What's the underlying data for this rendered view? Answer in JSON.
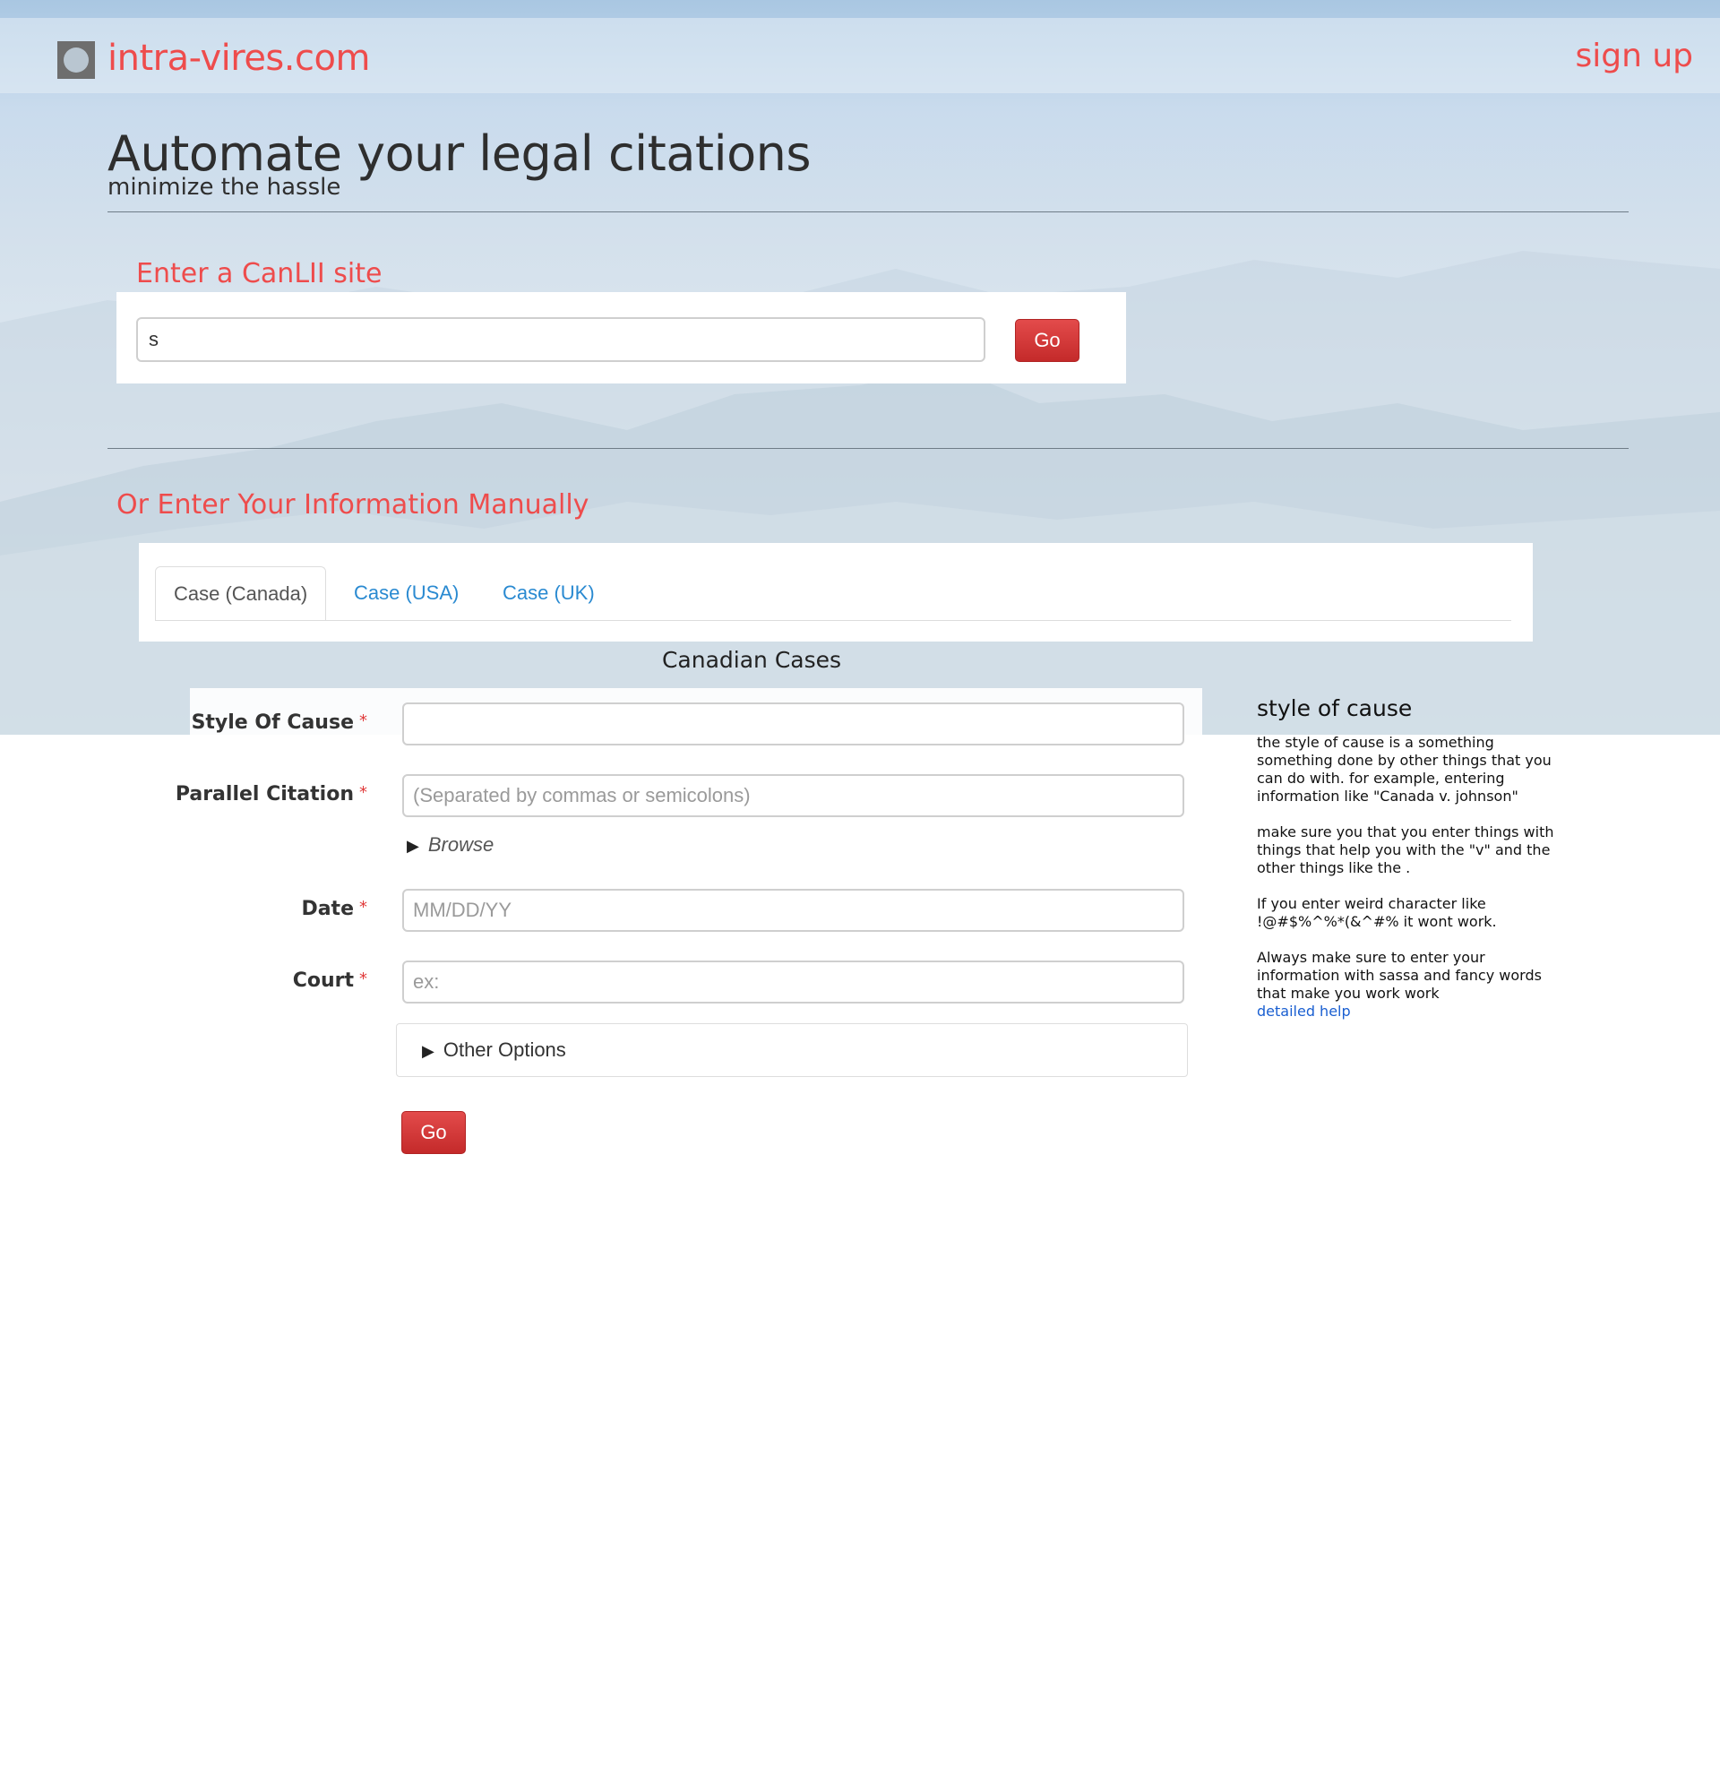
{
  "navbar": {
    "brand": "intra-vires.com",
    "signup": "sign up"
  },
  "hero": {
    "title": "Automate your legal citations",
    "subtitle": "minimize the hassle"
  },
  "canlii": {
    "heading": "Enter a CanLII site",
    "input_value": "s",
    "go_label": "Go"
  },
  "manual": {
    "heading": "Or Enter Your Information Manually",
    "tabs": [
      {
        "label": "Case (Canada)",
        "active": true
      },
      {
        "label": "Case (USA)",
        "active": false
      },
      {
        "label": "Case (UK)",
        "active": false
      }
    ],
    "section_title": "Canadian Cases"
  },
  "form": {
    "style_of_cause": {
      "label": "Style Of Cause",
      "required": "*",
      "value": "",
      "placeholder": ""
    },
    "parallel_citation": {
      "label": "Parallel Citation",
      "required": "*",
      "placeholder": "(Separated by commas or semicolons)"
    },
    "browse": "Browse",
    "date": {
      "label": "Date",
      "required": "*",
      "placeholder": "MM/DD/YY"
    },
    "court": {
      "label": "Court",
      "required": "*",
      "placeholder": "ex:"
    },
    "other_options": "Other Options",
    "go_label": "Go"
  },
  "help": {
    "title": "style of cause",
    "paragraphs": [
      "the style of cause is a something something done by other things that you can do with. for example, entering information like \"Canada v. johnson\"",
      "make sure you that you enter things with things that help you with the \"v\" and the other things like the .",
      "If you enter weird character like !@#$%^%*(&^#% it wont work.",
      "Always make sure to enter your information with sassa and fancy words that make you work work"
    ],
    "link": "detailed help"
  },
  "colors": {
    "accent": "#ee4c4c",
    "link": "#2a8ad1",
    "button": "#d23636"
  }
}
